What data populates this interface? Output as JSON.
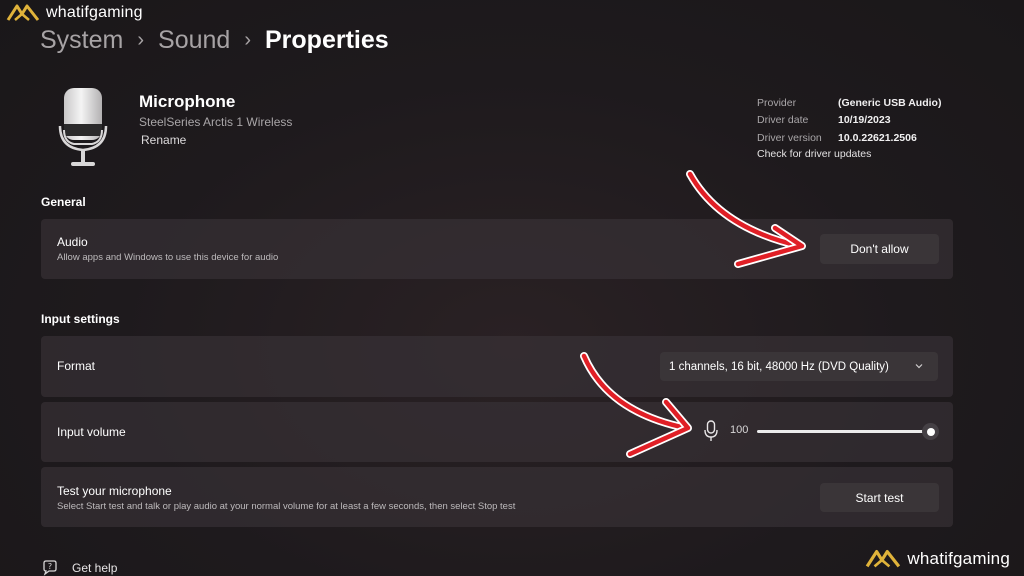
{
  "watermark": {
    "text": "whatifgaming",
    "brand_color": "#e0b33a"
  },
  "breadcrumb": [
    "System",
    "Sound",
    "Properties"
  ],
  "device": {
    "name": "Microphone",
    "model": "SteelSeries Arctis 1 Wireless",
    "rename_label": "Rename",
    "icon": "microphone-device-icon"
  },
  "driver": {
    "provider_label": "Provider",
    "provider_value": "(Generic USB Audio)",
    "date_label": "Driver date",
    "date_value": "10/19/2023",
    "version_label": "Driver version",
    "version_value": "10.0.22621.2506",
    "update_link": "Check for driver updates"
  },
  "general": {
    "title": "General",
    "audio": {
      "title": "Audio",
      "description": "Allow apps and Windows to use this device for audio",
      "button": "Don't allow"
    }
  },
  "input_settings": {
    "title": "Input settings",
    "format": {
      "label": "Format",
      "selected": "1 channels, 16 bit, 48000 Hz (DVD Quality)"
    },
    "volume": {
      "label": "Input volume",
      "value": "100",
      "level_percent": 100
    },
    "test": {
      "title": "Test your microphone",
      "description": "Select Start test and talk or play audio at your normal volume for at least a few seconds, then select Stop test",
      "button": "Start test"
    }
  },
  "help": {
    "label": "Get help"
  },
  "annotation_color": "#e01f26"
}
